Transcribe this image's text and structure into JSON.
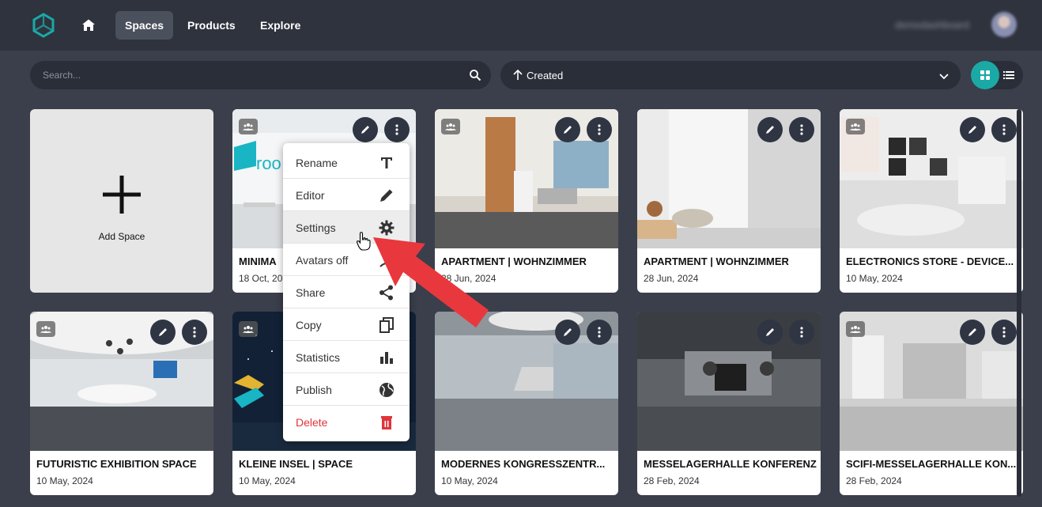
{
  "nav": {
    "items": [
      {
        "label": "Spaces"
      },
      {
        "label": "Products"
      },
      {
        "label": "Explore"
      }
    ],
    "user_name": "demodashboard"
  },
  "toolbar": {
    "search_placeholder": "Search...",
    "sort_label": "Created",
    "sort_direction": "ascending",
    "view_mode": "grid"
  },
  "add_space": {
    "label": "Add Space"
  },
  "cards": [
    {
      "title": "MINIMA",
      "date": "18 Oct, 2024"
    },
    {
      "title": "APARTMENT | WOHNZIMMER",
      "date": "28 Jun, 2024"
    },
    {
      "title": "APARTMENT | WOHNZIMMER",
      "date": "28 Jun, 2024"
    },
    {
      "title": "ELECTRONICS STORE - DEVICE...",
      "date": "10 May, 2024"
    },
    {
      "title": "FUTURISTIC EXHIBITION SPACE",
      "date": "10 May, 2024"
    },
    {
      "title": "KLEINE INSEL | SPACE",
      "date": "10 May, 2024"
    },
    {
      "title": "MODERNES KONGRESSZENTR...",
      "date": "10 May, 2024"
    },
    {
      "title": "MESSELAGERHALLE KONFERENZ",
      "date": "28 Feb, 2024"
    },
    {
      "title": "SCIFI-MESSELAGERHALLE KON...",
      "date": "28 Feb, 2024"
    }
  ],
  "context_menu": {
    "items": [
      {
        "label": "Rename",
        "icon": "text-icon"
      },
      {
        "label": "Editor",
        "icon": "pencil-icon"
      },
      {
        "label": "Settings",
        "icon": "gear-icon"
      },
      {
        "label": "Avatars off",
        "icon": "person-icon"
      },
      {
        "label": "Share",
        "icon": "share-icon"
      },
      {
        "label": "Copy",
        "icon": "copy-icon"
      },
      {
        "label": "Statistics",
        "icon": "bar-chart-icon"
      },
      {
        "label": "Publish",
        "icon": "globe-icon"
      },
      {
        "label": "Delete",
        "icon": "trash-icon"
      }
    ],
    "hovered": "Settings"
  },
  "colors": {
    "accent": "#1ba9a6",
    "background": "#3a3f4b",
    "topbar": "#2e333e",
    "danger": "#e0353a",
    "annotation_arrow": "#e8383d"
  }
}
